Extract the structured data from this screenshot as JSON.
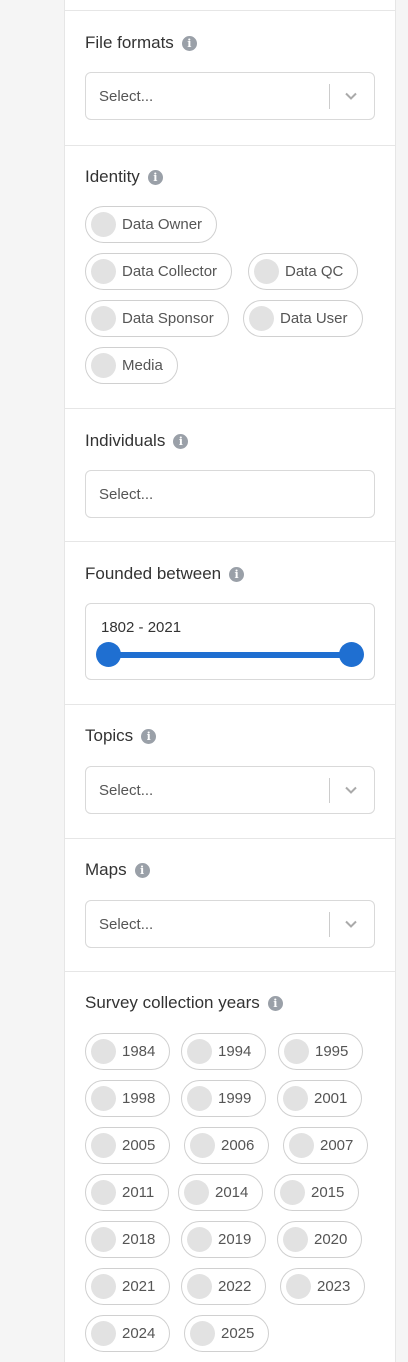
{
  "file_formats": {
    "title": "File formats",
    "placeholder": "Select..."
  },
  "identity": {
    "title": "Identity",
    "options": [
      "Data Owner",
      "Data Collector",
      "Data QC",
      "Data Sponsor",
      "Data User",
      "Media"
    ]
  },
  "individuals": {
    "title": "Individuals",
    "placeholder": "Select..."
  },
  "founded": {
    "title": "Founded between",
    "range_text": "1802 - 2021",
    "min": 1802,
    "max": 2021
  },
  "topics": {
    "title": "Topics",
    "placeholder": "Select..."
  },
  "maps": {
    "title": "Maps",
    "placeholder": "Select..."
  },
  "survey_years": {
    "title": "Survey collection years",
    "years": [
      "1984",
      "1994",
      "1995",
      "1998",
      "1999",
      "2001",
      "2005",
      "2006",
      "2007",
      "2011",
      "2014",
      "2015",
      "2018",
      "2019",
      "2020",
      "2021",
      "2022",
      "2023",
      "2024",
      "2025"
    ]
  },
  "colors": {
    "accent": "#1f6fd1",
    "info_icon": "#9aa0a8"
  },
  "icons": {
    "info": "info-icon",
    "dropdown": "chevron-down-icon"
  }
}
